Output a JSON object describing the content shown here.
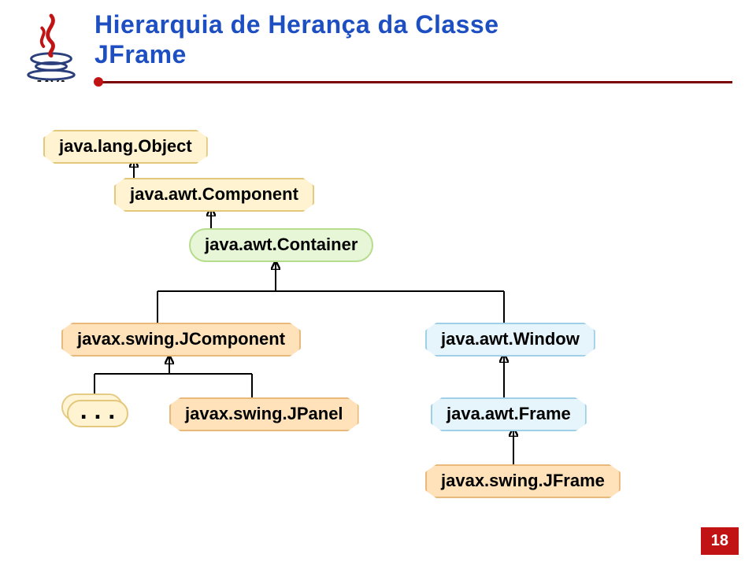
{
  "header": {
    "title_line1": "Hierarquia de Herança da Classe",
    "title_line2": "JFrame",
    "logo_alt": "Java"
  },
  "nodes": {
    "object": "java.lang.Object",
    "component": "java.awt.Component",
    "container": "java.awt.Container",
    "jcomponent": "javax.swing.JComponent",
    "window": "java.awt.Window",
    "jpanel": "javax.swing.JPanel",
    "frame": "java.awt.Frame",
    "jframe": "javax.swing.JFrame",
    "ellipsis": ". . ."
  },
  "page": {
    "number": "18"
  },
  "chart_data": {
    "type": "diagram",
    "title": "Hierarquia de Herança da Classe JFrame",
    "description": "UML-style class inheritance hierarchy for javax.swing.JFrame",
    "edges": [
      [
        "java.lang.Object",
        "java.awt.Component"
      ],
      [
        "java.awt.Component",
        "java.awt.Container"
      ],
      [
        "java.awt.Container",
        "javax.swing.JComponent"
      ],
      [
        "java.awt.Container",
        "java.awt.Window"
      ],
      [
        "javax.swing.JComponent",
        "..."
      ],
      [
        "javax.swing.JComponent",
        "javax.swing.JPanel"
      ],
      [
        "java.awt.Window",
        "java.awt.Frame"
      ],
      [
        "java.awt.Frame",
        "javax.swing.JFrame"
      ]
    ],
    "node_styles": {
      "java.lang.Object": "yellow",
      "java.awt.Component": "yellow",
      "java.awt.Container": "green",
      "javax.swing.JComponent": "peach",
      "java.awt.Window": "lightblue",
      "javax.swing.JPanel": "peach",
      "java.awt.Frame": "lightblue",
      "javax.swing.JFrame": "peach",
      "...": "yellow"
    }
  }
}
